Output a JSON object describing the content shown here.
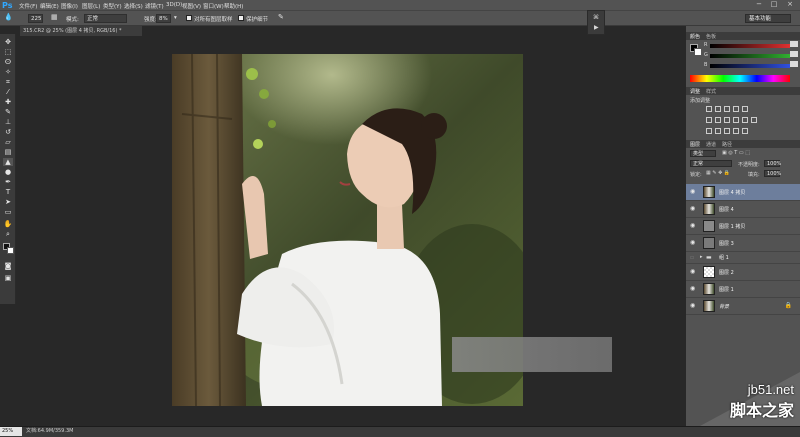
{
  "app": {
    "logo": "Ps"
  },
  "menu": [
    "文件(F)",
    "编辑(E)",
    "图像(I)",
    "图层(L)",
    "类型(Y)",
    "选择(S)",
    "滤镜(T)",
    "3D(D)",
    "视图(V)",
    "窗口(W)",
    "帮助(H)"
  ],
  "window_controls": [
    "−",
    "□",
    "×"
  ],
  "options": {
    "brush_size": "225",
    "mode_label": "模式:",
    "mode_value": "正常",
    "strength_label": "强度:",
    "strength_value": "8%",
    "sample_all_label": "对所有图层取样",
    "protect_detail_label": "保护细节"
  },
  "workspace": "基本功能",
  "document": {
    "tab": "315.CR2 @ 25% (图层 4 拷贝, RGB/16) *",
    "zoom": "25%",
    "size": "文档:64.9M/359.3M"
  },
  "tools": [
    "move-tool",
    "marquee-tool",
    "lasso-tool",
    "quick-select-tool",
    "crop-tool",
    "eyedropper-tool",
    "healing-tool",
    "brush-tool",
    "stamp-tool",
    "history-brush-tool",
    "eraser-tool",
    "gradient-tool",
    "blur-tool",
    "dodge-tool",
    "pen-tool",
    "type-tool",
    "path-select-tool",
    "shape-tool",
    "hand-tool",
    "zoom-tool"
  ],
  "color_panel": {
    "tabs": [
      "颜色",
      "色板"
    ],
    "channels": [
      {
        "label": "R",
        "color": "#e03030"
      },
      {
        "label": "G",
        "color": "#30b030"
      },
      {
        "label": "B",
        "color": "#3050e0"
      }
    ]
  },
  "adjust_panel": {
    "tabs": [
      "调整",
      "样式"
    ],
    "title": "添加调整"
  },
  "layers_panel": {
    "tabs": [
      "图层",
      "通道",
      "路径"
    ],
    "kind_label": "类型",
    "blend_mode": "正常",
    "opacity_label": "不透明度:",
    "opacity_value": "100%",
    "lock_label": "锁定:",
    "fill_label": "填充:",
    "fill_value": "100%",
    "layers": [
      {
        "name": "图层 4 拷贝",
        "thumb": "photo",
        "selected": true,
        "visible": true
      },
      {
        "name": "图层 4",
        "thumb": "photo",
        "selected": false,
        "visible": true
      },
      {
        "name": "图层 1 拷贝",
        "thumb": "gray",
        "selected": false,
        "visible": true
      },
      {
        "name": "图层 3",
        "thumb": "gray",
        "selected": false,
        "visible": true
      },
      {
        "name": "组 1",
        "thumb": "folder",
        "selected": false,
        "visible": false
      },
      {
        "name": "图层 2",
        "thumb": "checker",
        "selected": false,
        "visible": true
      },
      {
        "name": "图层 1",
        "thumb": "photo",
        "selected": false,
        "visible": true
      },
      {
        "name": "背景",
        "thumb": "photo",
        "selected": false,
        "visible": true,
        "locked": true
      }
    ]
  },
  "watermark": {
    "url": "jb51.net",
    "name": "脚本之家"
  }
}
